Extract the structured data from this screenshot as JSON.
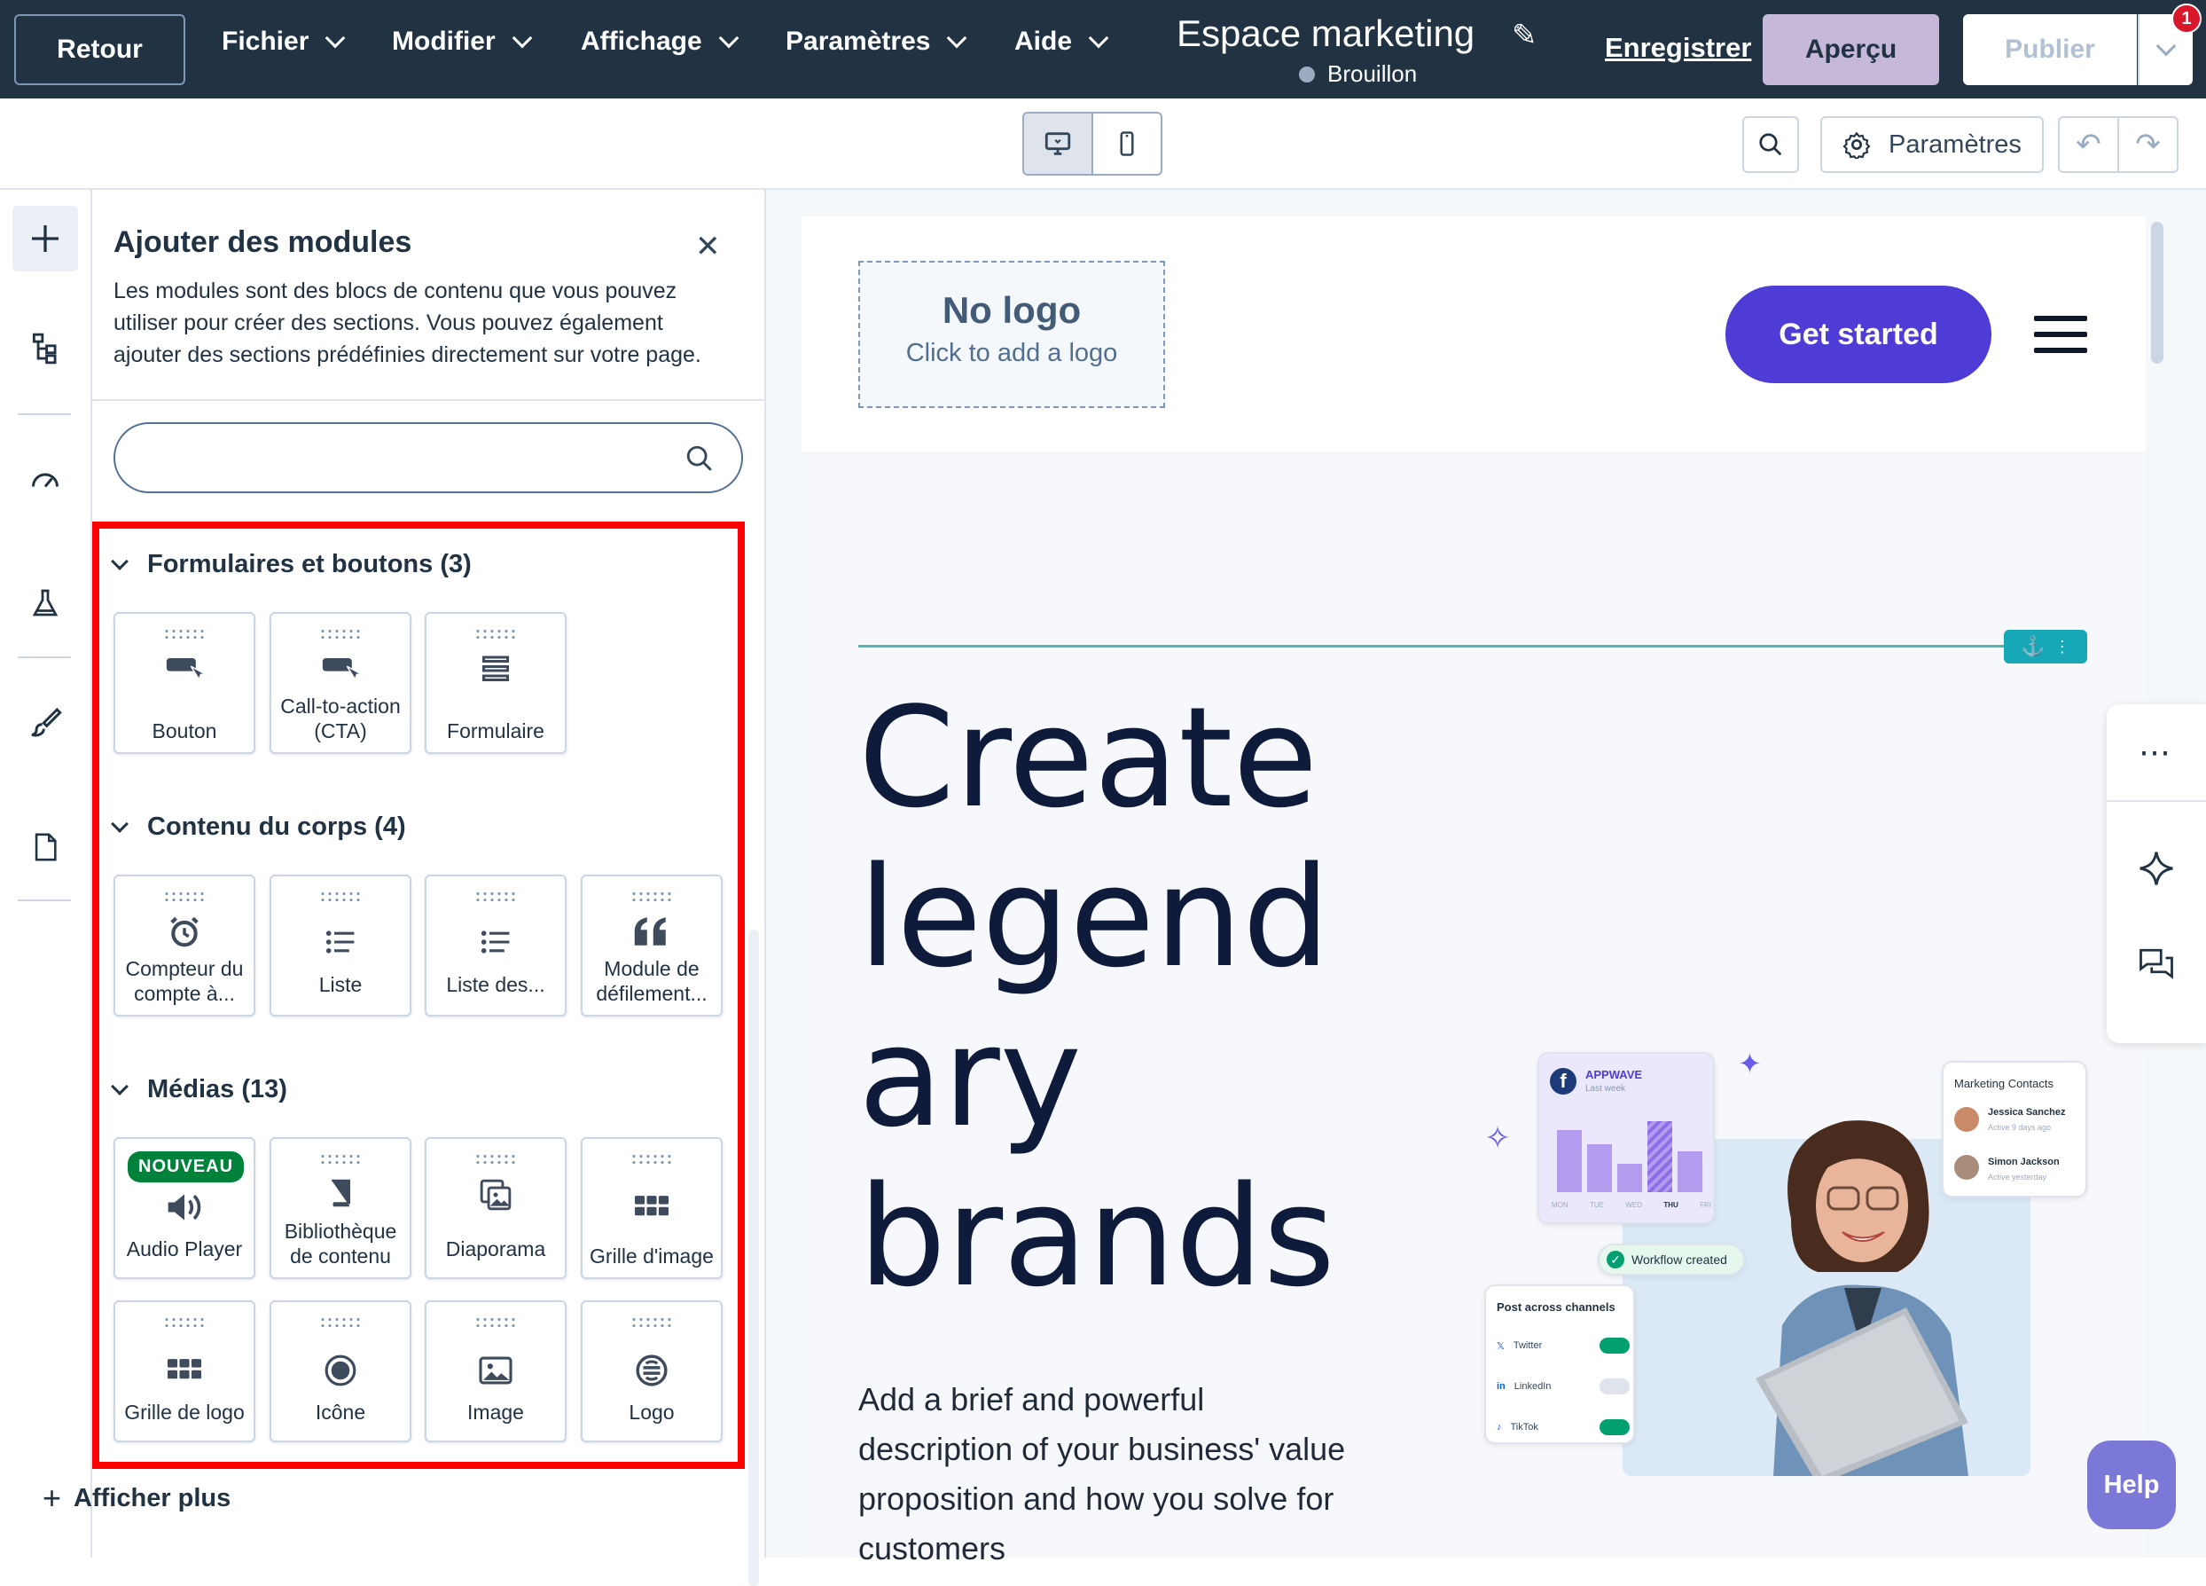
{
  "topbar": {
    "back_label": "Retour",
    "menus": [
      "Fichier",
      "Modifier",
      "Affichage",
      "Paramètres",
      "Aide"
    ],
    "page_title": "Espace marketing",
    "status": "Brouillon",
    "save_label": "Enregistrer",
    "preview_label": "Aperçu",
    "publish_label": "Publier",
    "notification_count": "1"
  },
  "toolbar": {
    "settings_label": "Paramètres"
  },
  "panel": {
    "title": "Ajouter des modules",
    "description": "Les modules sont des blocs de contenu que vous pouvez utiliser pour créer des sections. Vous pouvez également ajouter des sections prédéfinies directement sur votre page.",
    "search_placeholder": "",
    "sections": [
      {
        "title": "Formulaires et boutons (3)",
        "tiles": [
          "Bouton",
          "Call-to-action (CTA)",
          "Formulaire"
        ]
      },
      {
        "title": "Contenu du corps (4)",
        "tiles": [
          "Compteur du compte à...",
          "Liste",
          "Liste des...",
          "Module de défilement..."
        ]
      },
      {
        "title": "Médias (13)",
        "tiles": [
          "Audio Player",
          "Bibliothèque de contenu",
          "Diaporama",
          "Grille d'image",
          "Grille de logo",
          "Icône",
          "Image",
          "Logo"
        ]
      }
    ],
    "new_badge": "NOUVEAU",
    "show_more": "Afficher plus"
  },
  "page": {
    "logo_title": "No logo",
    "logo_sub": "Click to add a logo",
    "cta": "Get started",
    "hero_title_lines": [
      "Create",
      "legend",
      "ary",
      "brands"
    ],
    "hero_desc": "Add a brief and powerful description of your business' value proposition and how you solve for customers",
    "illus": {
      "appwave": "APPWAVE",
      "last_week": "Last week",
      "days": [
        "MON",
        "TUE",
        "WED",
        "THU",
        "FRI"
      ],
      "workflow": "Workflow created",
      "post_across": "Post across channels",
      "channels": [
        "Twitter",
        "LinkedIn",
        "TikTok"
      ],
      "contacts_title": "Marketing Contacts",
      "contact1": "Jessica Sanchez",
      "contact1_sub": "Active 9 days ago",
      "contact2": "Simon Jackson",
      "contact2_sub": "Active yesterday"
    }
  },
  "help_label": "Help",
  "colors": {
    "topbar": "#213343",
    "cta": "#4f3bd6",
    "highlight": "#ff0000",
    "teal": "#16a8b6"
  }
}
